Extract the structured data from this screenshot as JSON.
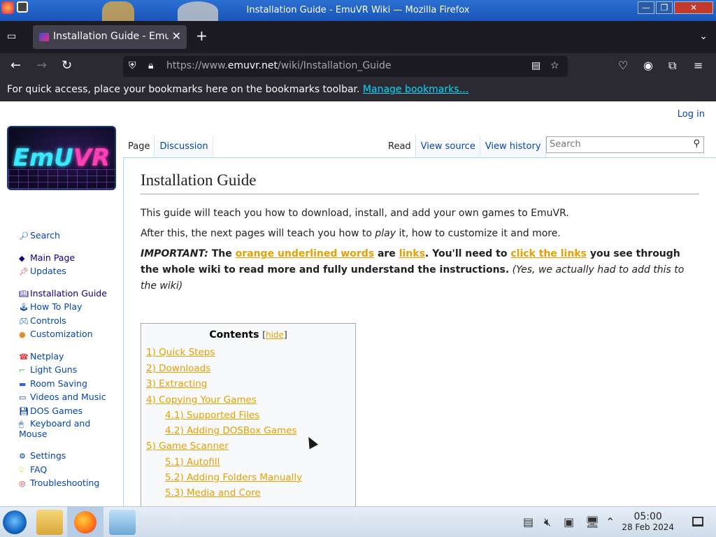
{
  "window": {
    "title": "Installation Guide - EmuVR Wiki — Mozilla Firefox",
    "minimize": "—",
    "maximize": "❐",
    "close": "✕"
  },
  "tabbar": {
    "tab_title": "Installation Guide - EmuVR Wiki",
    "tab_close": "✕",
    "new_tab": "+"
  },
  "navbar": {
    "url_prefix": "https://www.",
    "url_domain": "emuvr.net",
    "url_path": "/wiki/Installation_Guide"
  },
  "bookmarks": {
    "message": "For quick access, place your bookmarks here on the bookmarks toolbar.",
    "link": "Manage bookmarks…"
  },
  "wiki": {
    "login": "Log in",
    "logo_text_a": "EmU",
    "logo_text_b": "VR",
    "tabs_left": [
      "Page",
      "Discussion"
    ],
    "tabs_right": [
      "Read",
      "View source",
      "View history"
    ],
    "search_placeholder": "Search",
    "sidebar": {
      "search": "Search",
      "main_page": "Main Page",
      "updates": "Updates",
      "installation_guide": "Installation Guide",
      "how_to_play": "How To Play",
      "controls": "Controls",
      "customization": "Customization",
      "netplay": "Netplay",
      "light_guns": "Light Guns",
      "room_saving": "Room Saving",
      "videos_and_music": "Videos and Music",
      "dos_games": "DOS Games",
      "keyboard_and_mouse": "Keyboard and Mouse",
      "settings": "Settings",
      "faq": "FAQ",
      "troubleshooting": "Troubleshooting"
    },
    "article": {
      "title": "Installation Guide",
      "p1": "This guide will teach you how to download, install, and add your own games to EmuVR.",
      "p2_a": "After this, the next pages will teach you how to ",
      "p2_b": "play",
      "p2_c": " it, how to customize it and more.",
      "important_label": "IMPORTANT:",
      "important_1": " The ",
      "link_orange": "orange underlined words",
      "important_2": " are ",
      "link_links": "links",
      "important_3": ". You'll need to ",
      "link_click": "click the links",
      "important_4": " you see through the whole wiki to read more and fully understand the instructions.",
      "important_note": " (Yes, we actually had to add this to the wiki)"
    },
    "toc": {
      "title": "Contents",
      "hide": "hide",
      "entries": [
        "1) Quick Steps",
        "2) Downloads",
        "3) Extracting",
        "4) Copying Your Games",
        "4.1) Supported Files",
        "4.2) Adding DOSBox Games",
        "5) Game Scanner",
        "5.1) Autofill",
        "5.2) Adding Folders Manually",
        "5.3) Media and Core"
      ]
    }
  },
  "taskbar": {
    "time": "05:00",
    "date": "28 Feb 2024"
  }
}
